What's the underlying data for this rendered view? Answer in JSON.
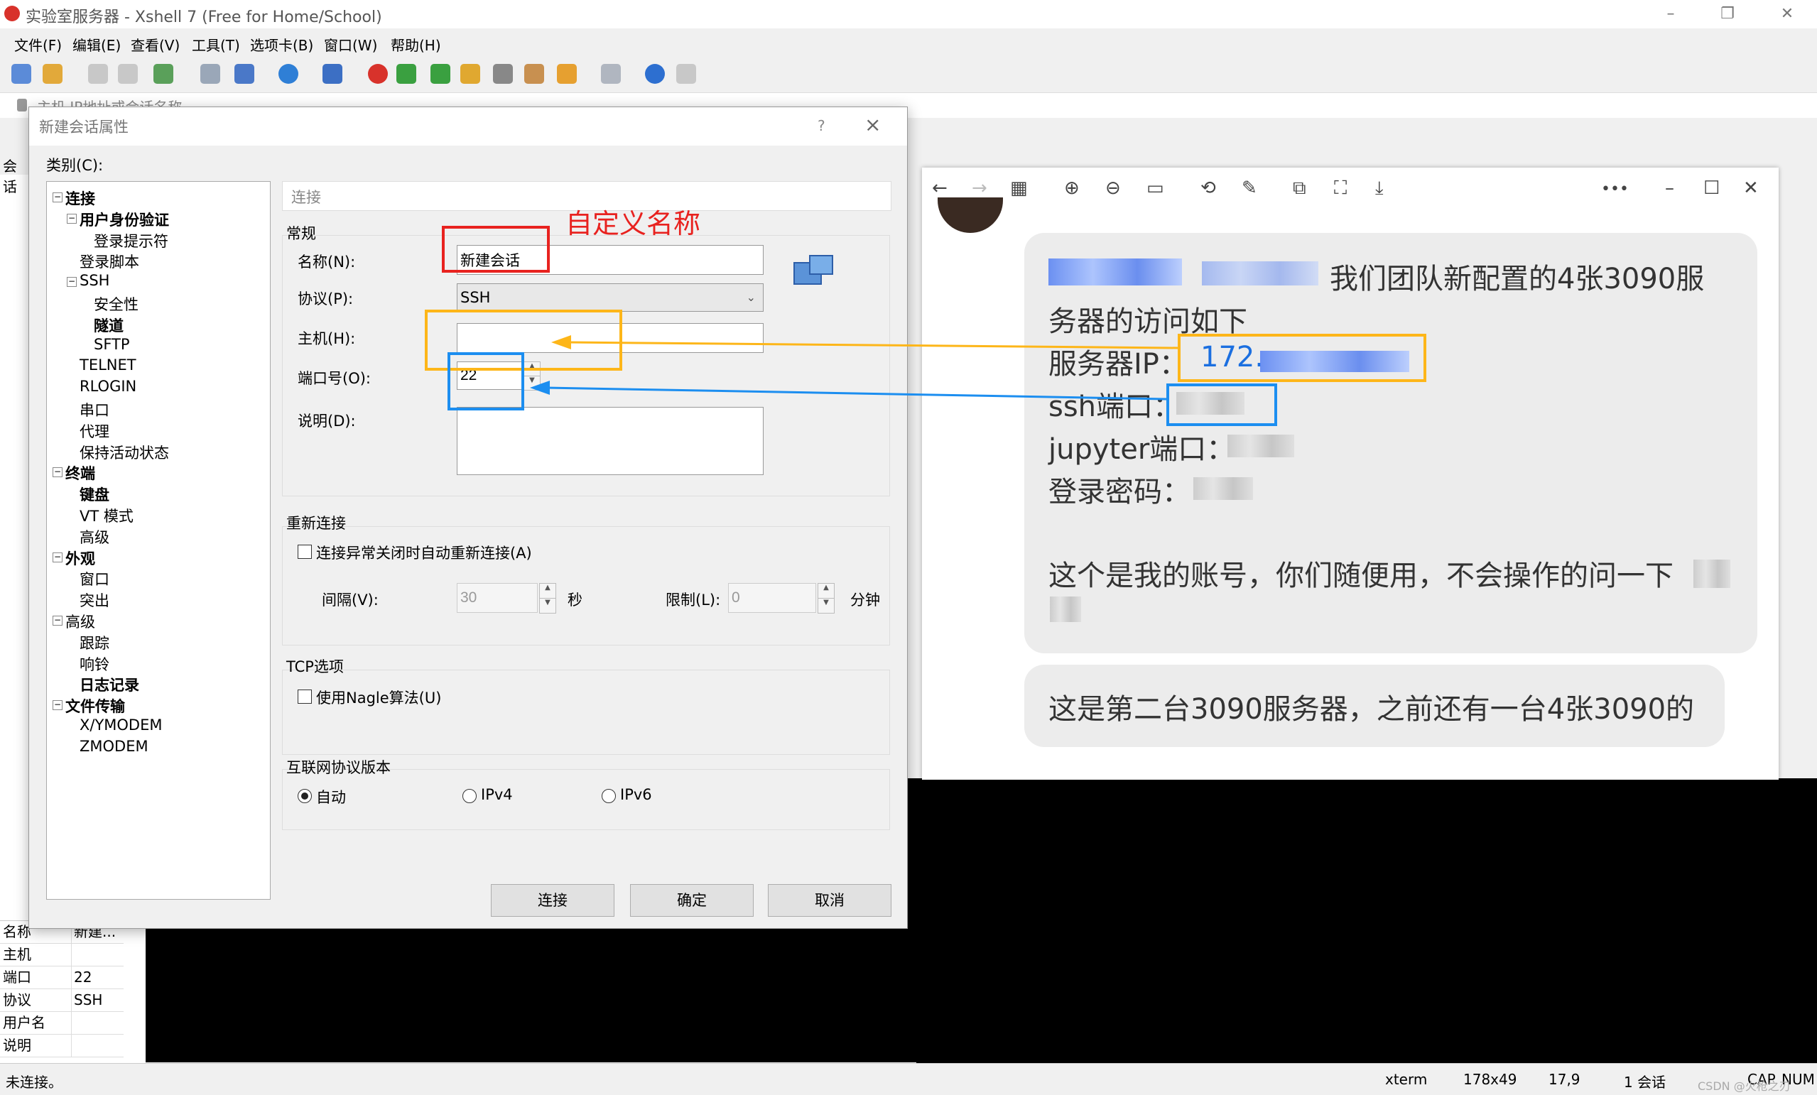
{
  "window": {
    "title": "实验室服务器 - Xshell 7 (Free for Home/School)"
  },
  "menu": [
    "文件(F)",
    "编辑(E)",
    "查看(V)",
    "工具(T)",
    "选项卡(B)",
    "窗口(W)",
    "帮助(H)"
  ],
  "address_bar": {
    "placeholder": "主机,IP地址或会话名称"
  },
  "left_pane": {
    "label": "会话"
  },
  "dialog": {
    "title": "新建会话属性",
    "help": "?",
    "close": "×",
    "category_label": "类别(C):",
    "tree": [
      {
        "label": "连接",
        "level": 0,
        "bold": true,
        "exp": "−"
      },
      {
        "label": "用户身份验证",
        "level": 1,
        "bold": true,
        "exp": "−"
      },
      {
        "label": "登录提示符",
        "level": 2,
        "bold": false
      },
      {
        "label": "登录脚本",
        "level": 1,
        "bold": false
      },
      {
        "label": "SSH",
        "level": 1,
        "bold": false,
        "exp": "−"
      },
      {
        "label": "安全性",
        "level": 2,
        "bold": false
      },
      {
        "label": "隧道",
        "level": 2,
        "bold": true
      },
      {
        "label": "SFTP",
        "level": 2,
        "bold": false
      },
      {
        "label": "TELNET",
        "level": 1,
        "bold": false
      },
      {
        "label": "RLOGIN",
        "level": 1,
        "bold": false
      },
      {
        "label": "串口",
        "level": 1,
        "bold": false
      },
      {
        "label": "代理",
        "level": 1,
        "bold": false
      },
      {
        "label": "保持活动状态",
        "level": 1,
        "bold": false
      },
      {
        "label": "终端",
        "level": 0,
        "bold": true,
        "exp": "−"
      },
      {
        "label": "键盘",
        "level": 1,
        "bold": true
      },
      {
        "label": "VT 模式",
        "level": 1,
        "bold": false
      },
      {
        "label": "高级",
        "level": 1,
        "bold": false
      },
      {
        "label": "外观",
        "level": 0,
        "bold": true,
        "exp": "−"
      },
      {
        "label": "窗口",
        "level": 1,
        "bold": false
      },
      {
        "label": "突出",
        "level": 1,
        "bold": false
      },
      {
        "label": "高级",
        "level": 0,
        "bold": false,
        "exp": "−"
      },
      {
        "label": "跟踪",
        "level": 1,
        "bold": false
      },
      {
        "label": "响铃",
        "level": 1,
        "bold": false
      },
      {
        "label": "日志记录",
        "level": 1,
        "bold": true
      },
      {
        "label": "文件传输",
        "level": 0,
        "bold": true,
        "exp": "−"
      },
      {
        "label": "X/YMODEM",
        "level": 1,
        "bold": false
      },
      {
        "label": "ZMODEM",
        "level": 1,
        "bold": false
      }
    ],
    "section_header": "连接",
    "general": {
      "group_label": "常规",
      "name_label": "名称(N):",
      "name_value": "新建会话",
      "protocol_label": "协议(P):",
      "protocol_value": "SSH",
      "host_label": "主机(H):",
      "host_value": "",
      "port_label": "端口号(O):",
      "port_value": "22",
      "desc_label": "说明(D):",
      "desc_value": ""
    },
    "reconnect": {
      "group_label": "重新连接",
      "auto_reconnect_label": "连接异常关闭时自动重新连接(A)",
      "interval_label": "间隔(V):",
      "interval_value": "30",
      "interval_unit": "秒",
      "limit_label": "限制(L):",
      "limit_value": "0",
      "limit_unit": "分钟"
    },
    "tcp": {
      "group_label": "TCP选项",
      "nagle_label": "使用Nagle算法(U)"
    },
    "ip_version": {
      "group_label": "互联网协议版本",
      "options": [
        "自动",
        "IPv4",
        "IPv6"
      ],
      "selected": "自动"
    },
    "buttons": {
      "connect": "连接",
      "ok": "确定",
      "cancel": "取消"
    }
  },
  "annotation": {
    "custom_name": "自定义名称"
  },
  "properties": [
    {
      "key": "名称",
      "value": "新建..."
    },
    {
      "key": "主机",
      "value": ""
    },
    {
      "key": "端口",
      "value": "22"
    },
    {
      "key": "协议",
      "value": "SSH"
    },
    {
      "key": "用户名",
      "value": ""
    },
    {
      "key": "说明",
      "value": ""
    }
  ],
  "status_bar": {
    "state": "未连接。",
    "term": "xterm",
    "size": "178x49",
    "cursor": "17,9",
    "sessions": "1 会话",
    "caps": "CAP",
    "num": "NUM",
    "watermark": "CSDN @火枪之刃"
  },
  "viewer": {
    "more_icon": "•••",
    "chat": {
      "line1": "我们团队新配置的4张3090服",
      "line2": "务器的访问如下",
      "ip_label": "服务器IP：",
      "ip_value": "172.",
      "ssh_label": "ssh端口：",
      "jupyter_label": "jupyter端口：",
      "password_label": "登录密码：",
      "note": "这个是我的账号，你们随便用，不会操作的问一下",
      "second": "这是第二台3090服务器，之前还有一台4张3090的"
    }
  },
  "colors": {
    "red_box": "#e8221f",
    "yellow_box": "#fdb619",
    "blue_box": "#1c8ef0",
    "link_blue": "#1b6fe0"
  }
}
